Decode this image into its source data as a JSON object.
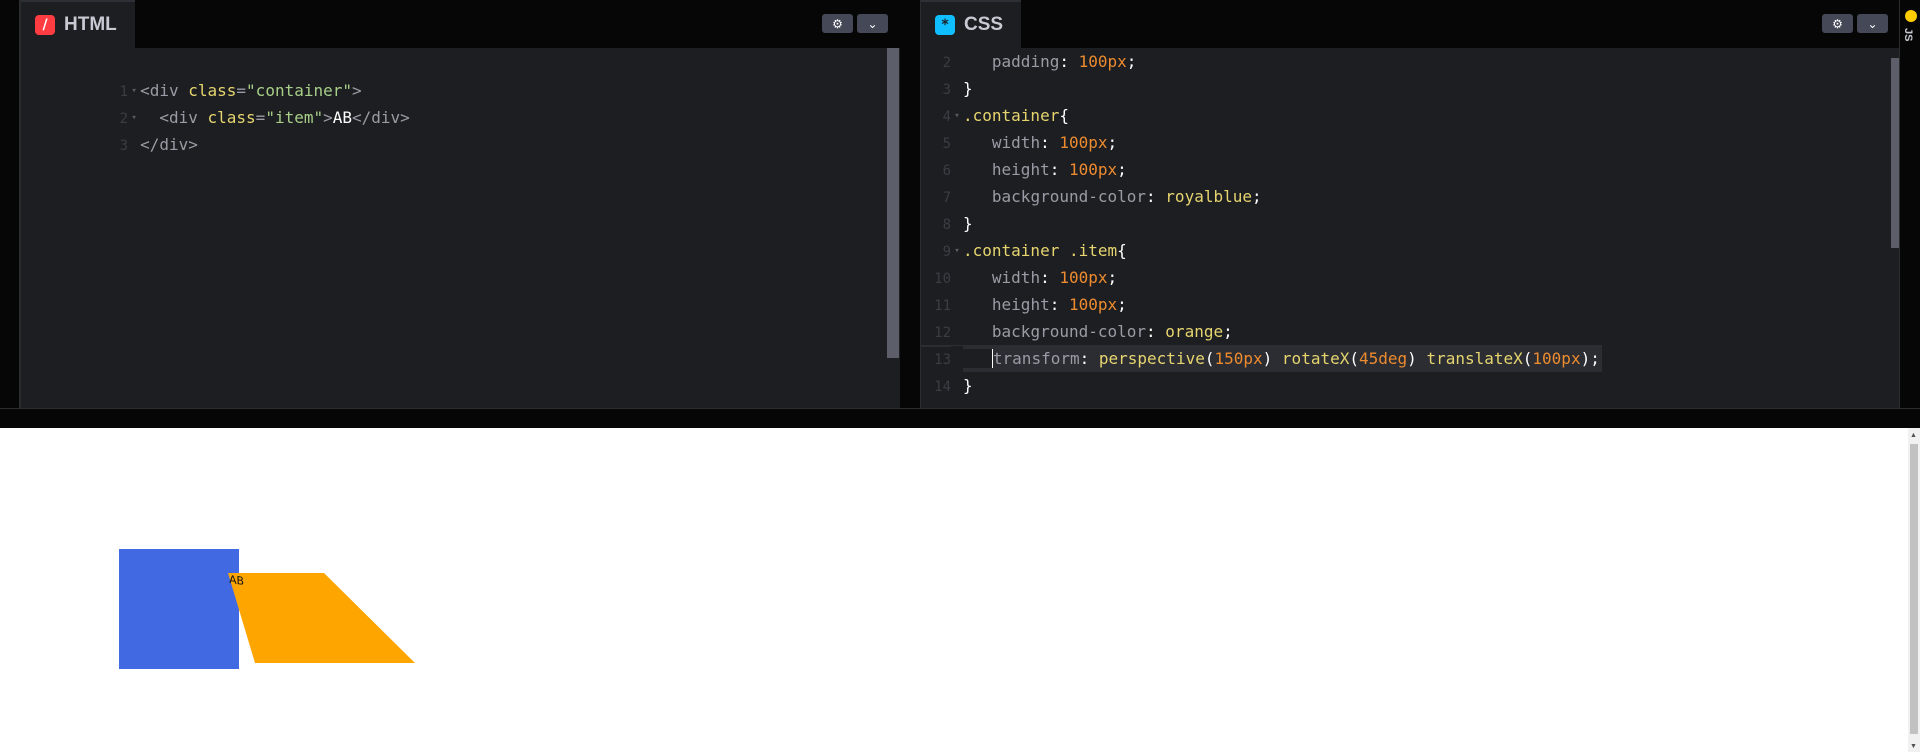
{
  "html_panel": {
    "title": "HTML",
    "settings_icon": "gear-icon",
    "collapse_icon": "chevron-down-icon",
    "lines": [
      {
        "num": "1",
        "fold": true
      },
      {
        "num": "2",
        "fold": true
      },
      {
        "num": "3",
        "fold": false
      }
    ],
    "code": {
      "l1_open": "<div ",
      "l1_attr": "class",
      "l1_eq": "=",
      "l1_str": "\"container\"",
      "l1_close": ">",
      "l2_indent": "  ",
      "l2_open": "<div ",
      "l2_attr": "class",
      "l2_eq": "=",
      "l2_str": "\"item\"",
      "l2_close": ">",
      "l2_text": "AB",
      "l2_end": "</div>",
      "l3_end": "</div>"
    }
  },
  "css_panel": {
    "title": "CSS",
    "settings_icon": "gear-icon",
    "collapse_icon": "chevron-down-icon",
    "line_numbers": [
      "2",
      "3",
      "4",
      "5",
      "6",
      "7",
      "8",
      "9",
      "10",
      "11",
      "12",
      "13",
      "14"
    ],
    "code": {
      "l2_prop": "padding",
      "l2_val": "100px",
      "l3": "}",
      "l4_sel": ".container",
      "l4_brace": "{",
      "l5_prop": "width",
      "l5_val": "100px",
      "l6_prop": "height",
      "l6_val": "100px",
      "l7_prop": "background-color",
      "l7_val": "royalblue",
      "l8": "}",
      "l9_sel": ".container .item",
      "l9_brace": "{",
      "l10_prop": "width",
      "l10_val": "100px",
      "l11_prop": "height",
      "l11_val": "100px",
      "l12_prop": "background-color",
      "l12_val": "orange",
      "l13_prop": "transform",
      "l13_f1": "perspective",
      "l13_a1": "150px",
      "l13_f2": "rotateX",
      "l13_a2": "45deg",
      "l13_f3": "translateX",
      "l13_a3": "100px",
      "l14": "}"
    }
  },
  "js_panel": {
    "label": "JS"
  },
  "preview": {
    "item_text": "AB",
    "container_color": "#4169e1",
    "item_color": "#ffa500"
  }
}
